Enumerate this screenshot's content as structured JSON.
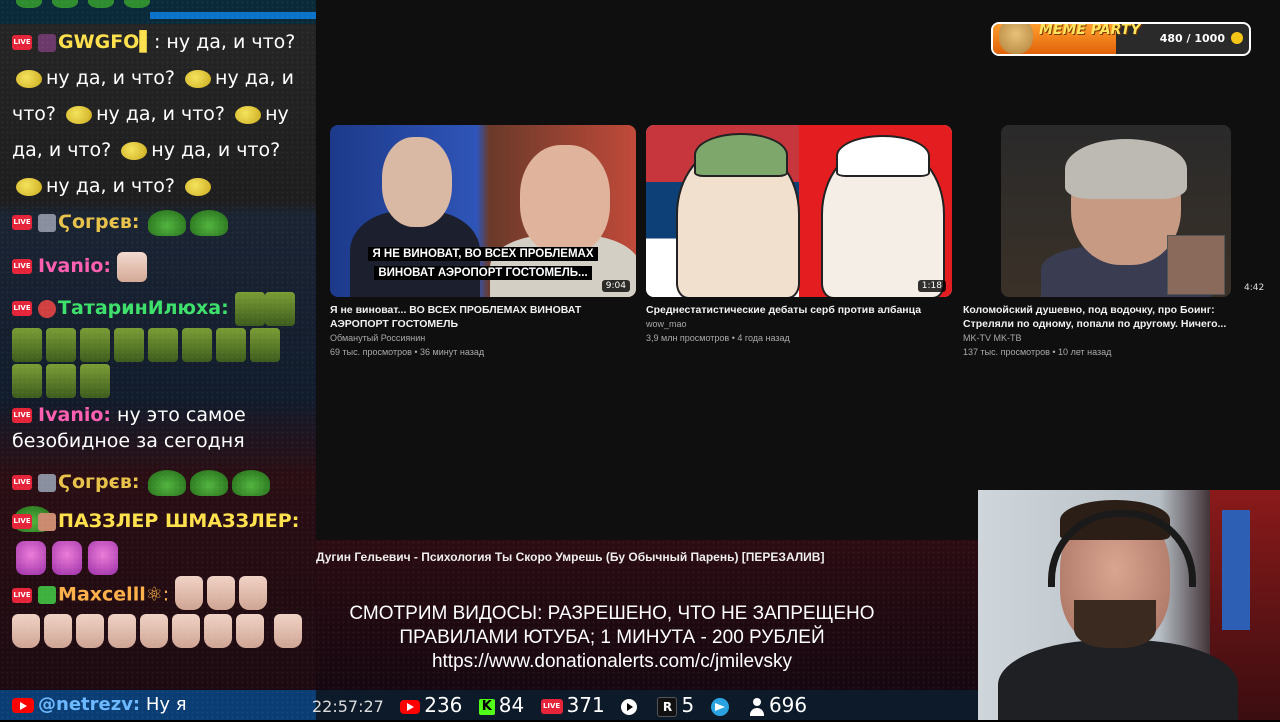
{
  "chat": {
    "messages": [
      {
        "user": "GWGFO",
        "text": ": ну да, и что?",
        "cont": [
          "ну да, и что?",
          "ну да, и",
          "что?",
          "ну да, и что?",
          "ну",
          "да, и что?",
          "ну да, и что?",
          "ну да, и что?"
        ]
      },
      {
        "user": "Ϛогрєв:"
      },
      {
        "user": "Ivanio:"
      },
      {
        "user": "ТатаринИлюха:"
      },
      {
        "user": "Ivanio:",
        "text": " ну это самое",
        "text2": "безобидное за сегодня"
      },
      {
        "user": "Ϛогрєв:"
      },
      {
        "user": "ПАЗЗЛЕР ШМАЗЗЛЕР:"
      },
      {
        "user": "Maxcelll",
        "badge": "⚛:"
      }
    ],
    "live_badge": "LIVE",
    "footer": {
      "user": "@netrezv:",
      "text": " Ну я"
    }
  },
  "videos": [
    {
      "title_line1": "Я не виноват... ВО ВСЕХ ПРОБЛЕМАХ ВИНОВАТ",
      "title_line2": "АЭРОПОРТ ГОСТОМЕЛЬ",
      "channel": "Обманутый Россиянин",
      "meta": "69 тыс. просмотров • 36 минут назад",
      "duration": "9:04",
      "caption1": "Я НЕ ВИНОВАТ, ВО ВСЕХ ПРОБЛЕМАХ",
      "caption2": "ВИНОВАТ АЭРОПОРТ ГОСТОМЕЛЬ..."
    },
    {
      "title_line1": "Среднестатистические дебаты серб против албанца",
      "title_line2": "",
      "channel": "wow_mao",
      "meta": "3,9 млн просмотров • 4 года назад",
      "duration": "1:18"
    },
    {
      "title_line1": "Коломойский душевно, под водочку, про Боинг:",
      "title_line2": "Стреляли по одному, попали по другому. Ничего...",
      "channel": "MK-TV MK-TB",
      "meta": "137 тыс. просмотров • 10 лет назад",
      "duration": "4:42"
    }
  ],
  "meme_party": {
    "title": "MEME PARTY",
    "count": "480 / 1000",
    "progress": 0.48
  },
  "marquee": "Дугин Гельевич - Психология Ты Скоро Умрешь (Бу Обычный Парень) [ПЕРЕЗАЛИВ]",
  "notice": {
    "line1": "СМОТРИМ ВИДОСЫ: РАЗРЕШЕНО, ЧТО НЕ ЗАПРЕЩЕНО",
    "line2": "ПРАВИЛАМИ ЮТУБА; 1 МИНУТА - 200 РУБЛЕЙ",
    "line3": "https://www.donationalerts.com/c/jmilevsky"
  },
  "stats": {
    "clock": "22:57:27",
    "youtube": "236",
    "kick": "84",
    "live": "371",
    "rutube": "5",
    "total": "696",
    "live_label": "LIVE",
    "kick_label": "K",
    "rutube_label": "R"
  }
}
